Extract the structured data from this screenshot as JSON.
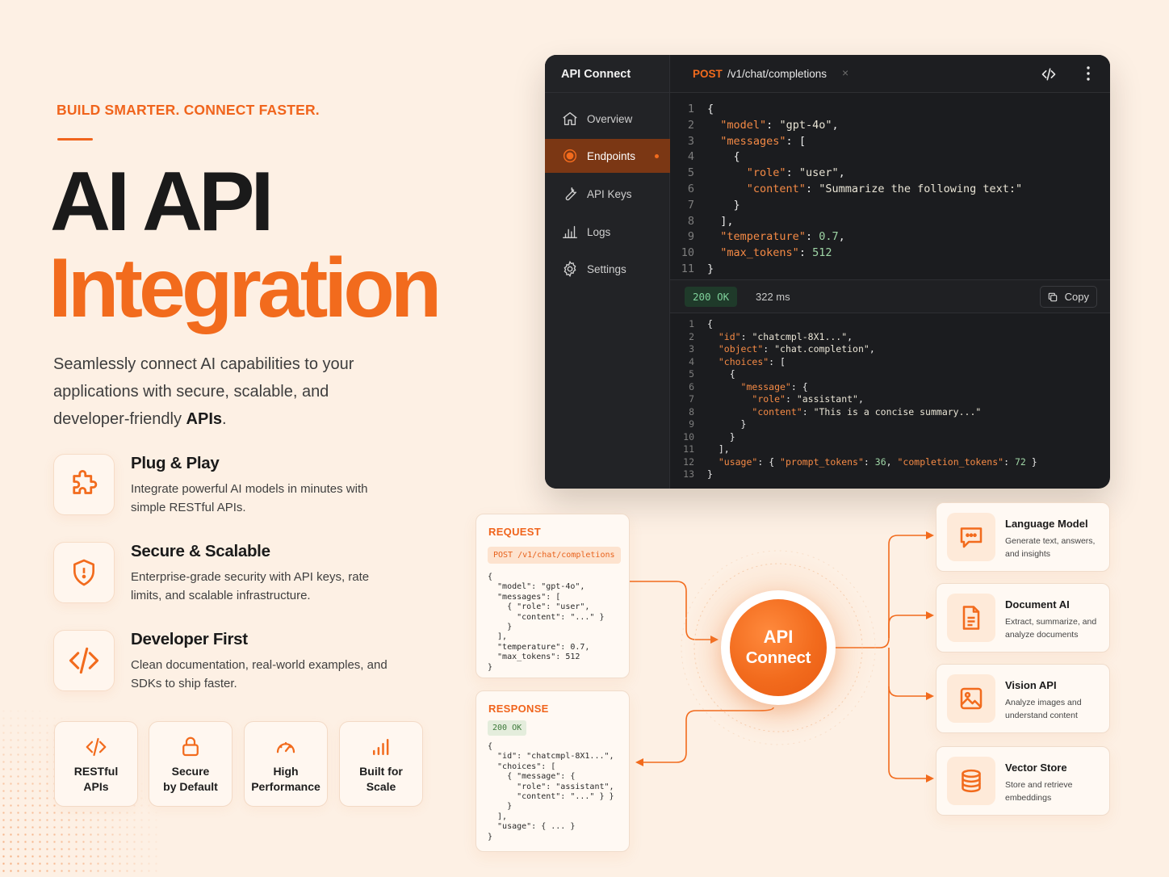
{
  "hero": {
    "eyebrow": "BUILD SMARTER. CONNECT FASTER.",
    "title_line1": "AI API",
    "title_line2": "Integration",
    "lead_main": "Seamlessly connect AI capabilities to your applications with secure, scalable, and developer-friendly ",
    "lead_bold": "APIs",
    "lead_end": "."
  },
  "features": [
    {
      "icon": "puzzle-icon",
      "title": "Plug & Play",
      "desc": "Integrate powerful AI models in minutes with simple RESTful APIs."
    },
    {
      "icon": "shield-icon",
      "title": "Secure & Scalable",
      "desc": "Enterprise-grade security with API keys, rate limits, and scalable infrastructure."
    },
    {
      "icon": "code-icon",
      "title": "Developer First",
      "desc": "Clean documentation, real-world examples, and SDKs to ship faster."
    }
  ],
  "badges": [
    {
      "icon": "code-icon",
      "label": "RESTful\nAPIs"
    },
    {
      "icon": "lock-icon",
      "label": "Secure\nby Default"
    },
    {
      "icon": "gauge-icon",
      "label": "High\nPerformance"
    },
    {
      "icon": "bar-chart-icon",
      "label": "Built for\nScale"
    }
  ],
  "window": {
    "app_name": "API Connect",
    "nav": [
      {
        "icon": "home-icon",
        "label": "Overview"
      },
      {
        "icon": "target-icon",
        "label": "Endpoints",
        "active": true
      },
      {
        "icon": "wrench-icon",
        "label": "API Keys"
      },
      {
        "icon": "chart-icon",
        "label": "Logs"
      },
      {
        "icon": "gear-icon",
        "label": "Settings"
      }
    ],
    "tab_method": "POST",
    "tab_path": "/v1/chat/completions",
    "tab_close": "×",
    "status": "200 OK",
    "time": "322 ms",
    "copy_label": "Copy",
    "request_lines": [
      "{",
      "  \"model\": \"gpt-4o\",",
      "  \"messages\": [",
      "    {",
      "      \"role\": \"user\",",
      "      \"content\": \"Summarize the following text:\"",
      "    }",
      "  ],",
      "  \"temperature\": 0.7,",
      "  \"max_tokens\": 512",
      "}"
    ],
    "response_lines": [
      "{",
      "  \"id\": \"chatcmpl-8X1...\",",
      "  \"object\": \"chat.completion\",",
      "  \"choices\": [",
      "    {",
      "      \"message\": {",
      "        \"role\": \"assistant\",",
      "        \"content\": \"This is a concise summary...\"",
      "      }",
      "    }",
      "  ],",
      "  \"usage\": { \"prompt_tokens\": 36, \"completion_tokens\": 72 }",
      "}"
    ]
  },
  "request_card": {
    "title": "REQUEST",
    "chip": "POST /v1/chat/completions",
    "code": "{\n  \"model\": \"gpt-4o\",\n  \"messages\": [\n    { \"role\": \"user\",\n      \"content\": \"...\" }\n    }\n  ],\n  \"temperature\": 0.7,\n  \"max_tokens\": 512\n}"
  },
  "response_card": {
    "title": "RESPONSE",
    "chip": "200 OK",
    "code": "{\n  \"id\": \"chatcmpl-8X1...\",\n  \"choices\": [\n    { \"message\": {\n      \"role\": \"assistant\",\n      \"content\": \"...\" } }\n    }\n  ],\n  \"usage\": { ... }\n}"
  },
  "hub": {
    "line1": "API",
    "line2": "Connect"
  },
  "services": [
    {
      "icon": "chat-icon",
      "title": "Language Model",
      "desc": "Generate text, answers, and insights"
    },
    {
      "icon": "document-icon",
      "title": "Document AI",
      "desc": "Extract, summarize, and analyze documents"
    },
    {
      "icon": "image-icon",
      "title": "Vision API",
      "desc": "Analyze images and understand content"
    },
    {
      "icon": "database-icon",
      "title": "Vector Store",
      "desc": "Store and retrieve embeddings"
    }
  ],
  "colors": {
    "accent": "#f26b1d",
    "dark": "#1b1c1f",
    "background": "#fdf0e4"
  }
}
